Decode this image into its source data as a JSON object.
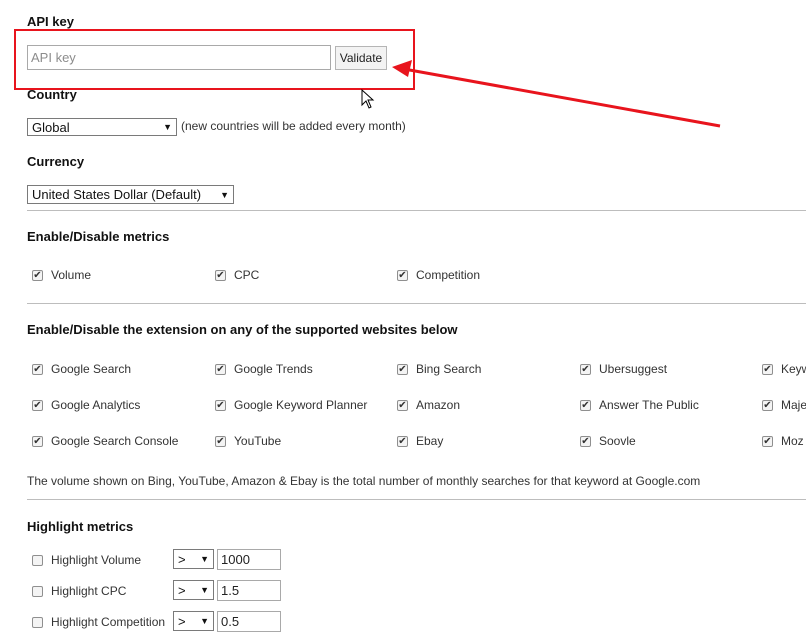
{
  "api_key": {
    "heading": "API key",
    "placeholder": "API key",
    "validate_label": "Validate"
  },
  "country": {
    "heading": "Country",
    "selected": "Global",
    "note": "(new countries will be added every month)"
  },
  "currency": {
    "heading": "Currency",
    "selected": "United States Dollar (Default)"
  },
  "metrics": {
    "heading": "Enable/Disable metrics",
    "items": [
      {
        "label": "Volume",
        "checked": true
      },
      {
        "label": "CPC",
        "checked": true
      },
      {
        "label": "Competition",
        "checked": true
      }
    ]
  },
  "websites": {
    "heading": "Enable/Disable the extension on any of the supported websites below",
    "items": [
      {
        "label": "Google Search",
        "checked": true
      },
      {
        "label": "Google Trends",
        "checked": true
      },
      {
        "label": "Bing Search",
        "checked": true
      },
      {
        "label": "Ubersuggest",
        "checked": true
      },
      {
        "label": "Keyw",
        "checked": true
      },
      {
        "label": "Google Analytics",
        "checked": true
      },
      {
        "label": "Google Keyword Planner",
        "checked": true
      },
      {
        "label": "Amazon",
        "checked": true
      },
      {
        "label": "Answer The Public",
        "checked": true
      },
      {
        "label": "Maje",
        "checked": true
      },
      {
        "label": "Google Search Console",
        "checked": true
      },
      {
        "label": "YouTube",
        "checked": true
      },
      {
        "label": "Ebay",
        "checked": true
      },
      {
        "label": "Soovle",
        "checked": true
      },
      {
        "label": "Moz",
        "checked": true
      }
    ],
    "note": "The volume shown on Bing, YouTube, Amazon & Ebay is the total number of monthly searches for that keyword at Google.com"
  },
  "highlight": {
    "heading": "Highlight metrics",
    "rows": [
      {
        "label": "Highlight Volume",
        "checked": false,
        "operator": ">",
        "value": "1000"
      },
      {
        "label": "Highlight CPC",
        "checked": false,
        "operator": ">",
        "value": "1.5"
      },
      {
        "label": "Highlight Competition",
        "checked": false,
        "operator": ">",
        "value": "0.5"
      }
    ]
  },
  "icons": {
    "check": "checkmark-icon",
    "dropdown": "dropdown-caret-icon",
    "cursor": "mouse-pointer-icon",
    "annotation": "red-arrow-icon"
  },
  "colors": {
    "annotation_red": "#e8141d"
  }
}
